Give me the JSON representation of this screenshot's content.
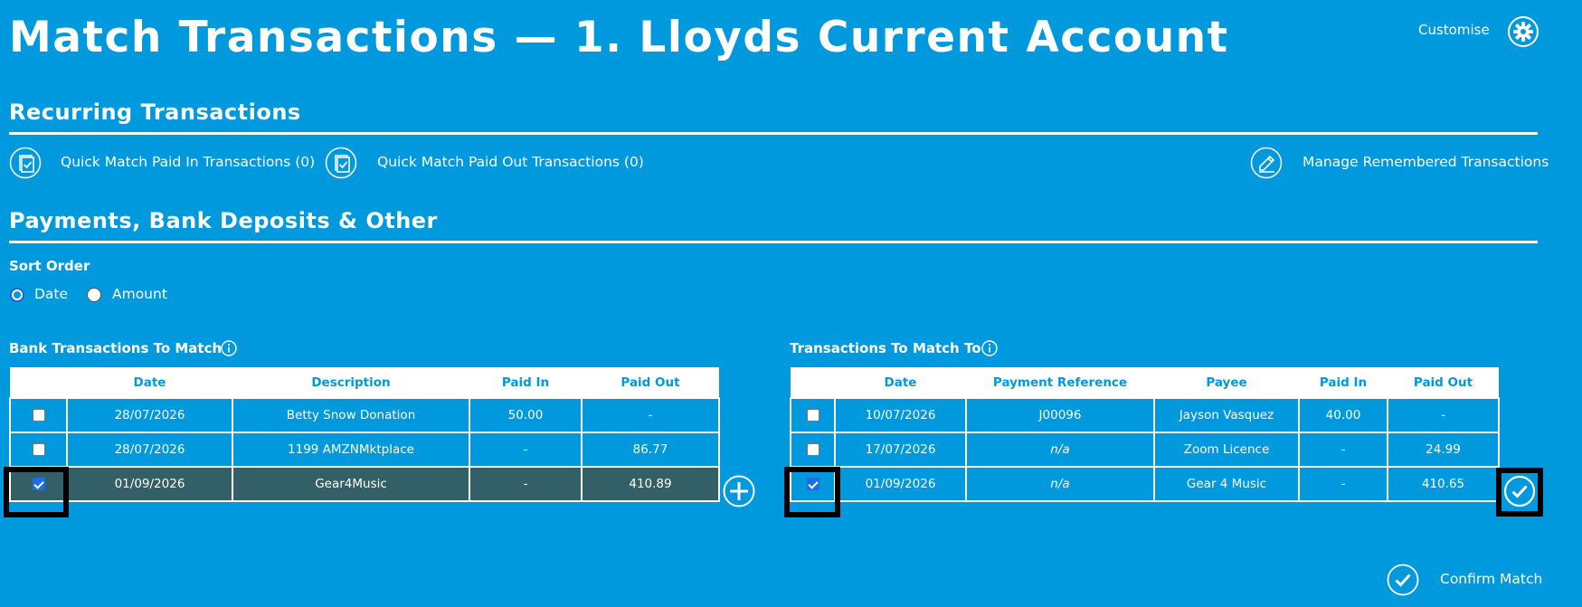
{
  "header": {
    "title": "Match Transactions — 1. Lloyds Current Account",
    "customise_label": "Customise",
    "settings_icon": "gear-icon"
  },
  "recurring": {
    "heading": "Recurring Transactions",
    "quick_paid_in": "Quick Match Paid In Transactions (0)",
    "quick_paid_out": "Quick Match Paid Out Transactions (0)",
    "manage": "Manage Remembered Transactions"
  },
  "payments": {
    "heading": "Payments, Bank Deposits & Other",
    "sort_order_label": "Sort Order",
    "sort_options": [
      "Date",
      "Amount"
    ],
    "sort_selected": "Date"
  },
  "bank": {
    "title": "Bank Transactions To Match",
    "columns": [
      "",
      "Date",
      "Description",
      "Paid In",
      "Paid Out"
    ],
    "rows": [
      {
        "checked": false,
        "date": "28/07/2026",
        "description": "Betty Snow Donation",
        "paid_in": "50.00",
        "paid_out": "-"
      },
      {
        "checked": false,
        "date": "28/07/2026",
        "description": "1199 AMZNMktplace",
        "paid_in": "-",
        "paid_out": "86.77"
      },
      {
        "checked": true,
        "date": "01/09/2026",
        "description": "Gear4Music",
        "paid_in": "-",
        "paid_out": "410.89"
      }
    ]
  },
  "match_to": {
    "title": "Transactions To Match To",
    "columns": [
      "",
      "Date",
      "Payment Reference",
      "Payee",
      "Paid In",
      "Paid Out"
    ],
    "rows": [
      {
        "checked": false,
        "date": "10/07/2026",
        "reference": "J00096",
        "payee": "Jayson Vasquez",
        "paid_in": "40.00",
        "paid_out": "-"
      },
      {
        "checked": false,
        "date": "17/07/2026",
        "reference": "n/a",
        "payee": "Zoom Licence",
        "paid_in": "-",
        "paid_out": "24.99"
      },
      {
        "checked": true,
        "date": "01/09/2026",
        "reference": "n/a",
        "payee": "Gear 4 Music",
        "paid_in": "-",
        "paid_out": "410.65"
      }
    ]
  },
  "footer": {
    "confirm_label": "Confirm Match"
  },
  "colors": {
    "background": "#0099dd",
    "selected_row": "#335f66",
    "highlight": "#000000"
  }
}
